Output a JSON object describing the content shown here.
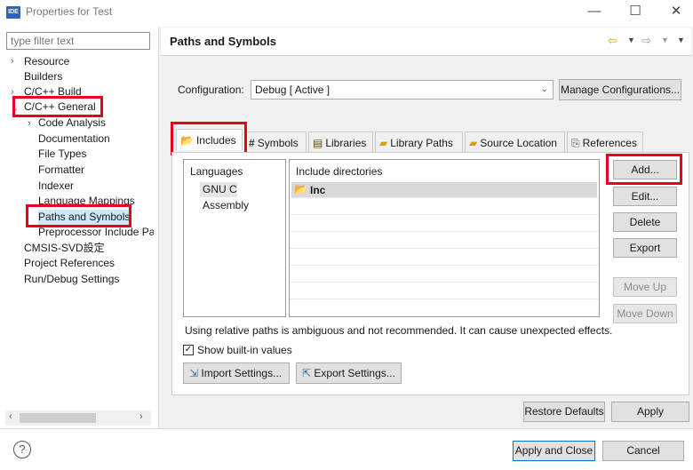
{
  "window": {
    "logo": "IDE",
    "title": "Properties for Test",
    "min_icon": "—",
    "max_icon": "☐",
    "close_icon": "✕"
  },
  "filter": {
    "placeholder": "type filter text"
  },
  "tree": {
    "resource": "Resource",
    "builders": "Builders",
    "cpp_build": "C/C++ Build",
    "cpp_general": "C/C++ General",
    "code_analysis": "Code Analysis",
    "documentation": "Documentation",
    "file_types": "File Types",
    "formatter": "Formatter",
    "indexer": "Indexer",
    "language_mappings": "Language Mappings",
    "paths_symbols": "Paths and Symbols",
    "preprocessor": "Preprocessor Include Pat",
    "cmsis": "CMSIS-SVD設定",
    "project_refs": "Project References",
    "run_debug": "Run/Debug Settings"
  },
  "page": {
    "title": "Paths and Symbols"
  },
  "config": {
    "label": "Configuration:",
    "value": "Debug  [ Active ]",
    "manage": "Manage Configurations..."
  },
  "tabs": {
    "includes": "Includes",
    "symbols": "Symbols",
    "libraries": "Libraries",
    "library_paths": "Library Paths",
    "source_location": "Source Location",
    "references": "References"
  },
  "languages": {
    "header": "Languages",
    "items": [
      "GNU C",
      "Assembly"
    ]
  },
  "includes": {
    "header": "Include directories",
    "items": [
      "Inc"
    ]
  },
  "side_buttons": {
    "add": "Add...",
    "edit": "Edit...",
    "delete": "Delete",
    "export": "Export",
    "move_up": "Move Up",
    "move_down": "Move Down"
  },
  "warning": "Using relative paths is ambiguous and not recommended. It can cause unexpected effects.",
  "show_builtin": {
    "label": "Show built-in values",
    "checked": true
  },
  "import_settings": "Import Settings...",
  "export_settings": "Export Settings...",
  "restore_defaults": "Restore Defaults",
  "apply": "Apply",
  "apply_close": "Apply and Close",
  "cancel": "Cancel",
  "help": "?",
  "highlight_color": "#e8001c"
}
